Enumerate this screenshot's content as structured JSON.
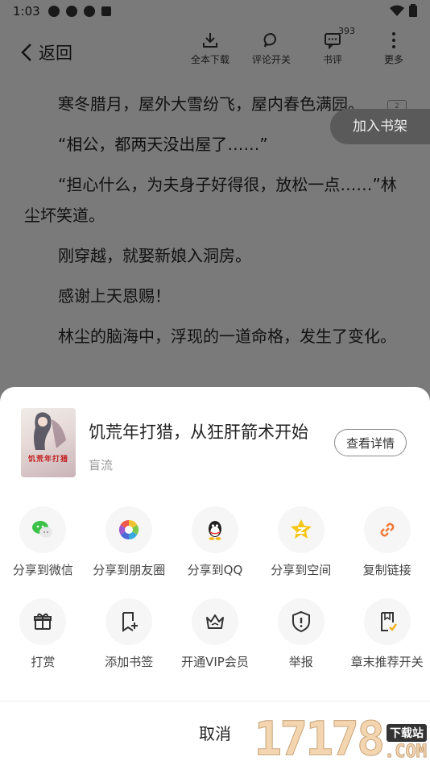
{
  "status": {
    "time": "1:03"
  },
  "topbar": {
    "back_label": "返回",
    "tools": [
      {
        "label": "全本下载",
        "icon": "download-icon"
      },
      {
        "label": "评论开关",
        "icon": "comment-toggle-icon"
      },
      {
        "label": "书评",
        "icon": "review-icon",
        "badge": "393"
      },
      {
        "label": "更多",
        "icon": "more-icon"
      }
    ]
  },
  "reader": {
    "paragraphs": [
      "寒冬腊月，屋外大雪纷飞，屋内春色满园。",
      "“相公，都两天没出屋了……”",
      "“担心什么，为夫身子好得很，放松一点……”林尘坏笑道。",
      "刚穿越，就娶新娘入洞房。",
      "感谢上天恩赐！",
      "林尘的脑海中，浮现的一道命格，发生了变化。"
    ],
    "page_tag": "2",
    "add_shelf_label": "加入书架"
  },
  "share_sheet": {
    "book_title": "饥荒年打猎，从狂肝箭术开始",
    "book_author": "盲流",
    "cover_text": "饥荒年打猎",
    "detail_label": "查看详情",
    "row1": [
      {
        "label": "分享到微信",
        "icon": "wechat-icon"
      },
      {
        "label": "分享到朋友圈",
        "icon": "moments-icon"
      },
      {
        "label": "分享到QQ",
        "icon": "qq-icon"
      },
      {
        "label": "分享到空间",
        "icon": "qzone-icon"
      },
      {
        "label": "复制链接",
        "icon": "link-icon"
      }
    ],
    "row2": [
      {
        "label": "打赏",
        "icon": "gift-icon"
      },
      {
        "label": "添加书签",
        "icon": "bookmark-add-icon"
      },
      {
        "label": "开通VIP会员",
        "icon": "crown-icon"
      },
      {
        "label": "举报",
        "icon": "report-icon"
      },
      {
        "label": "章末推荐开关",
        "icon": "recommend-toggle-icon"
      }
    ],
    "cancel_label": "取消"
  },
  "watermark": {
    "number": "17178",
    "tag": "下载站",
    "domain": ".COM"
  },
  "colors": {
    "accent_orange": "#f07a3a",
    "wechat_green": "#3cc24a",
    "qzone_yellow": "#f5c518"
  }
}
